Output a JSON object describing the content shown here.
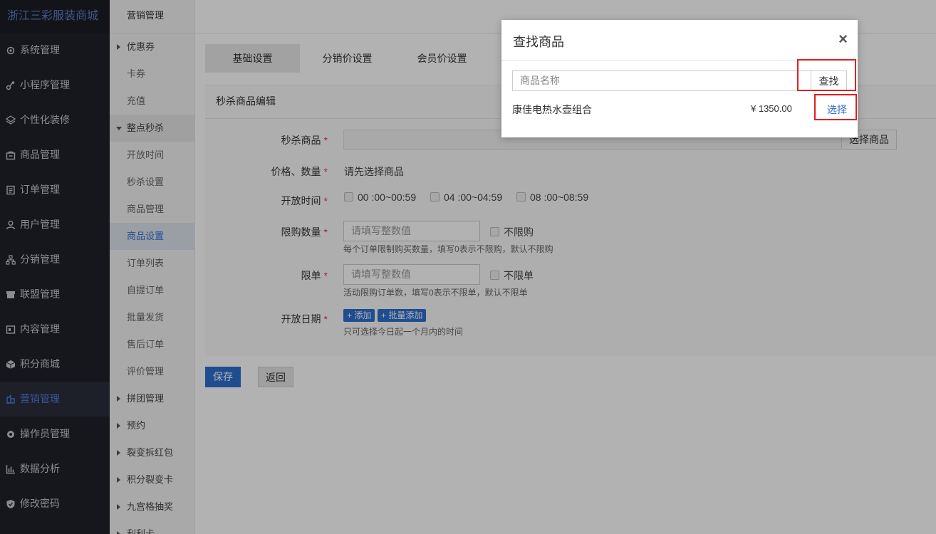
{
  "brand": "浙江三彩服装商城",
  "sidebar": [
    {
      "label": "系统管理",
      "icon": "gear-icon"
    },
    {
      "label": "小程序管理",
      "icon": "link-icon"
    },
    {
      "label": "个性化装修",
      "icon": "layers-icon"
    },
    {
      "label": "商品管理",
      "icon": "shop-icon"
    },
    {
      "label": "订单管理",
      "icon": "document-icon"
    },
    {
      "label": "用户管理",
      "icon": "user-icon"
    },
    {
      "label": "分销管理",
      "icon": "tree-icon"
    },
    {
      "label": "联盟管理",
      "icon": "store-icon"
    },
    {
      "label": "内容管理",
      "icon": "content-icon"
    },
    {
      "label": "积分商城",
      "icon": "cube-icon"
    },
    {
      "label": "营销管理",
      "icon": "marketing-icon",
      "active": true
    },
    {
      "label": "操作员管理",
      "icon": "gear-solid-icon"
    },
    {
      "label": "数据分析",
      "icon": "bar-chart-icon"
    },
    {
      "label": "修改密码",
      "icon": "shield-icon"
    }
  ],
  "subnav": {
    "header": "营销管理",
    "items": [
      {
        "label": "优惠券",
        "type": "group"
      },
      {
        "label": "卡券",
        "type": "child"
      },
      {
        "label": "充值",
        "type": "child"
      },
      {
        "label": "整点秒杀",
        "type": "group-open"
      },
      {
        "label": "开放时间",
        "type": "child"
      },
      {
        "label": "秒杀设置",
        "type": "child"
      },
      {
        "label": "商品管理",
        "type": "child"
      },
      {
        "label": "商品设置",
        "type": "active"
      },
      {
        "label": "订单列表",
        "type": "child"
      },
      {
        "label": "自提订单",
        "type": "child"
      },
      {
        "label": "批量发货",
        "type": "child"
      },
      {
        "label": "售后订单",
        "type": "child"
      },
      {
        "label": "评价管理",
        "type": "child"
      },
      {
        "label": "拼团管理",
        "type": "group"
      },
      {
        "label": "预约",
        "type": "group"
      },
      {
        "label": "裂变拆红包",
        "type": "group"
      },
      {
        "label": "积分裂变卡",
        "type": "group"
      },
      {
        "label": "九宫格抽奖",
        "type": "group"
      },
      {
        "label": "利利卡",
        "type": "group"
      }
    ]
  },
  "tabs": [
    "基础设置",
    "分销价设置",
    "会员价设置"
  ],
  "form": {
    "title": "秒杀商品编辑",
    "goods_label": "秒杀商品",
    "select_goods_btn": "选择商品",
    "price_label": "价格、数量",
    "price_value": "请先选择商品",
    "time_label": "开放时间",
    "time_slots": [
      "00 :00~00:59",
      "04 :00~04:59",
      "08 :00~08:59"
    ],
    "limit_label": "限购数量",
    "limit_placeholder": "请填写整数值",
    "limit_check": "不限购",
    "limit_hint": "每个订单限制购买数量，填写0表示不限购，默认不限购",
    "order_limit_label": "限单",
    "order_limit_placeholder": "请填写整数值",
    "order_limit_check": "不限单",
    "order_limit_hint": "活动限购订单数，填写0表示不限单，默认不限单",
    "date_label": "开放日期",
    "add_btn": "+ 添加",
    "batch_add_btn": "+ 批量添加",
    "date_hint": "只可选择今日起一个月内的时间",
    "required_mark": "*"
  },
  "actions": {
    "save": "保存",
    "back": "返回"
  },
  "modal": {
    "title": "查找商品",
    "close": "×",
    "search_placeholder": "商品名称",
    "search_btn": "查找",
    "result_name": "康佳电热水壶组合",
    "result_price": "¥ 1350.00",
    "result_select": "选择"
  }
}
